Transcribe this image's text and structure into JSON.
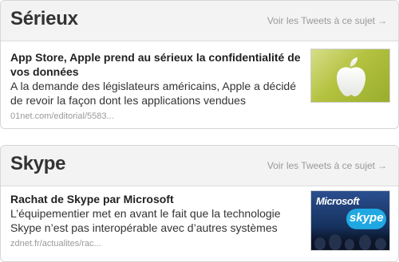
{
  "cards": [
    {
      "title": "Sérieux",
      "see_link": "Voir les Tweets à ce sujet",
      "arrow": "→",
      "story": {
        "title": "App Store, Apple prend au sérieux la confidentialité de vos données",
        "summary": "A la demande des législateurs américains, Apple a décidé de revoir la façon dont les applications vendues",
        "source": "01net.com/editorial/5583..."
      },
      "thumbnail_icon": "apple-logo-icon"
    },
    {
      "title": "Skype",
      "see_link": "Voir les Tweets à ce sujet",
      "arrow": "→",
      "story": {
        "title": "Rachat de Skype par Microsoft",
        "summary": "L’équipementier met en avant le fait que la technologie Skype n’est pas interopérable avec d’autres systèmes",
        "source": "zdnet.fr/actualites/rac..."
      },
      "thumbnail_text": {
        "microsoft": "Microsoft",
        "skype": "skype"
      }
    }
  ],
  "colors": {
    "header_bg": "#f3f3f3",
    "border": "#d6d6d6",
    "muted_text": "#999999",
    "apple_thumb": "#b3c23f",
    "skype_blue": "#20a8e2"
  }
}
